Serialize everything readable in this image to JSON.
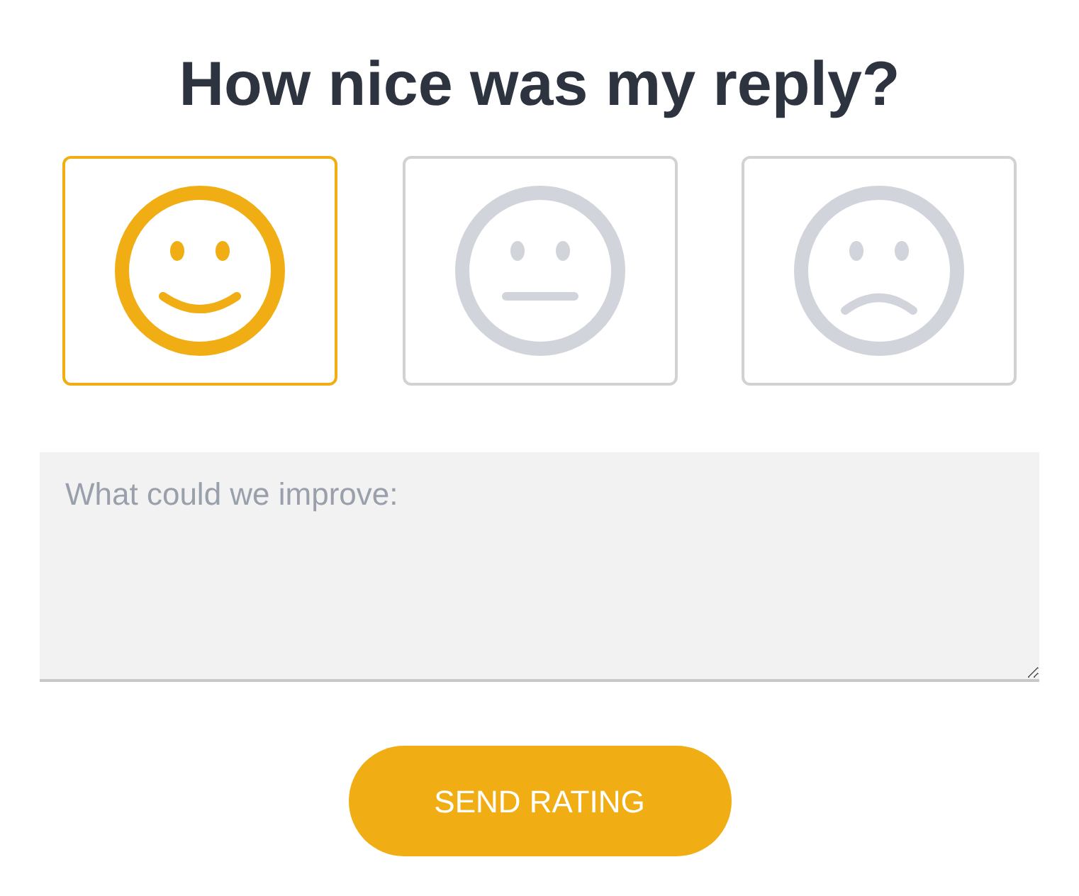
{
  "title": "How nice was my reply?",
  "ratings": [
    {
      "kind": "happy",
      "selected": true
    },
    {
      "kind": "neutral",
      "selected": false
    },
    {
      "kind": "sad",
      "selected": false
    }
  ],
  "comment": {
    "placeholder": "What could we improve:"
  },
  "button": {
    "label": "SEND RATING"
  }
}
